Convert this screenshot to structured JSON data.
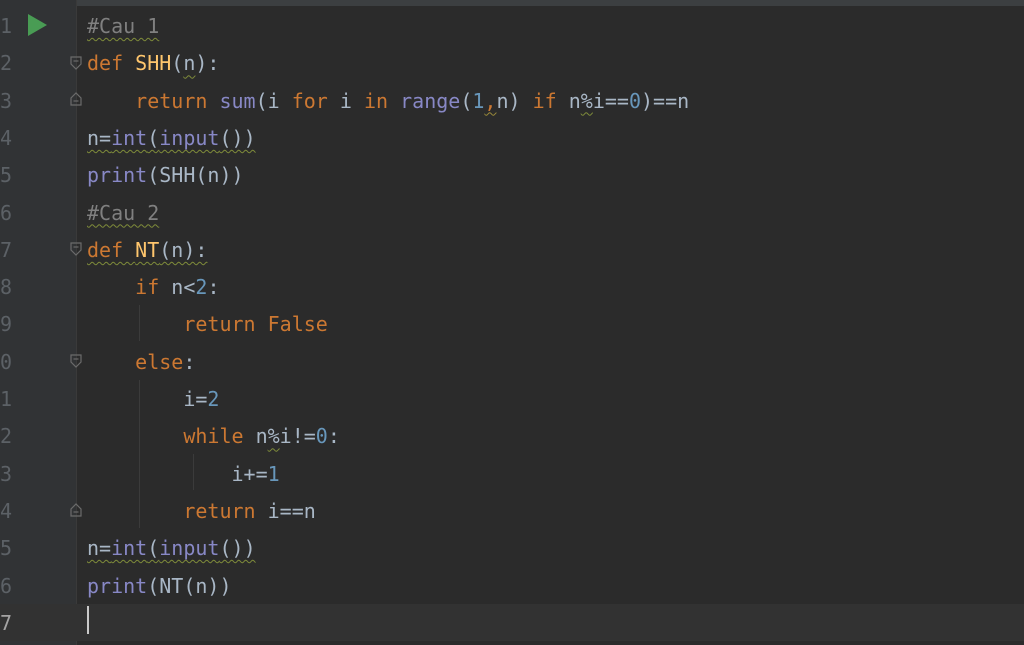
{
  "editor": {
    "gutter_numbers": [
      "1",
      "2",
      "3",
      "4",
      "5",
      "6",
      "7",
      "8",
      "9",
      "0",
      "1",
      "2",
      "3",
      "4",
      "5",
      "6",
      "7"
    ],
    "current_line_index": 16,
    "lines": [
      [
        {
          "t": "#Cau 1",
          "c": "cm sq"
        }
      ],
      [
        {
          "t": "def ",
          "c": "kw"
        },
        {
          "t": "SHH",
          "c": "fn"
        },
        {
          "t": "(",
          "c": ""
        },
        {
          "t": "n",
          "c": "sq"
        },
        {
          "t": "):",
          "c": ""
        }
      ],
      [
        {
          "t": "    ",
          "c": ""
        },
        {
          "t": "return ",
          "c": "kw"
        },
        {
          "t": "sum",
          "c": "bi"
        },
        {
          "t": "(i ",
          "c": ""
        },
        {
          "t": "for ",
          "c": "kw"
        },
        {
          "t": "i ",
          "c": ""
        },
        {
          "t": "in ",
          "c": "kw"
        },
        {
          "t": "range",
          "c": "bi"
        },
        {
          "t": "(",
          "c": ""
        },
        {
          "t": "1",
          "c": "numlit"
        },
        {
          "t": ",",
          "c": "kw sq2"
        },
        {
          "t": "n) ",
          "c": ""
        },
        {
          "t": "if ",
          "c": "kw"
        },
        {
          "t": "n",
          "c": ""
        },
        {
          "t": "%",
          "c": "sq"
        },
        {
          "t": "i==",
          "c": ""
        },
        {
          "t": "0",
          "c": "numlit"
        },
        {
          "t": ")==n",
          "c": ""
        }
      ],
      [
        {
          "t": "n=",
          "c": "sq"
        },
        {
          "t": "int",
          "c": "bi sq"
        },
        {
          "t": "(",
          "c": "sq"
        },
        {
          "t": "input",
          "c": "bi sq"
        },
        {
          "t": "())",
          "c": "sq"
        }
      ],
      [
        {
          "t": "print",
          "c": "bi"
        },
        {
          "t": "(SHH(n))",
          "c": ""
        }
      ],
      [
        {
          "t": "#Cau 2",
          "c": "cm sq"
        }
      ],
      [
        {
          "t": "def ",
          "c": "kw sq"
        },
        {
          "t": "NT",
          "c": "fn sq"
        },
        {
          "t": "(n):",
          "c": "sq"
        }
      ],
      [
        {
          "t": "    ",
          "c": ""
        },
        {
          "t": "if ",
          "c": "kw"
        },
        {
          "t": "n<",
          "c": ""
        },
        {
          "t": "2",
          "c": "numlit"
        },
        {
          "t": ":",
          "c": ""
        }
      ],
      [
        {
          "t": "        ",
          "c": ""
        },
        {
          "t": "return ",
          "c": "kw"
        },
        {
          "t": "False",
          "c": "kw"
        }
      ],
      [
        {
          "t": "    ",
          "c": ""
        },
        {
          "t": "else",
          "c": "kw"
        },
        {
          "t": ":",
          "c": ""
        }
      ],
      [
        {
          "t": "        ",
          "c": ""
        },
        {
          "t": "i=",
          "c": ""
        },
        {
          "t": "2",
          "c": "numlit"
        }
      ],
      [
        {
          "t": "        ",
          "c": ""
        },
        {
          "t": "while ",
          "c": "kw"
        },
        {
          "t": "n",
          "c": ""
        },
        {
          "t": "%",
          "c": "sq"
        },
        {
          "t": "i!=",
          "c": ""
        },
        {
          "t": "0",
          "c": "numlit"
        },
        {
          "t": ":",
          "c": ""
        }
      ],
      [
        {
          "t": "            ",
          "c": ""
        },
        {
          "t": "i+=",
          "c": ""
        },
        {
          "t": "1",
          "c": "numlit"
        }
      ],
      [
        {
          "t": "        ",
          "c": ""
        },
        {
          "t": "return ",
          "c": "kw"
        },
        {
          "t": "i==n",
          "c": ""
        }
      ],
      [
        {
          "t": "n=",
          "c": "sq"
        },
        {
          "t": "int",
          "c": "bi sq"
        },
        {
          "t": "(",
          "c": "sq"
        },
        {
          "t": "input",
          "c": "bi sq"
        },
        {
          "t": "())",
          "c": "sq"
        }
      ],
      [
        {
          "t": "print",
          "c": "bi"
        },
        {
          "t": "(NT(n))",
          "c": ""
        }
      ],
      []
    ]
  },
  "colors": {
    "background": "#2b2b2b",
    "gutter": "#313335",
    "keyword": "#cc7832",
    "function": "#ffc66d",
    "builtin": "#8888c6",
    "number": "#6897bb",
    "comment": "#808080",
    "default": "#a9b7c6",
    "run_icon": "#499c54"
  },
  "icons": {
    "run": "run-gutter-icon",
    "fold": "fold-marker-icon"
  }
}
